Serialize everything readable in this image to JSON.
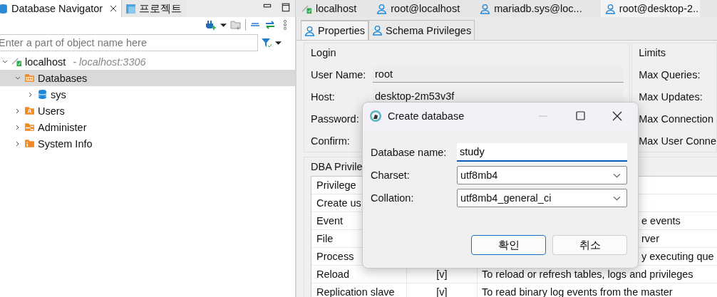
{
  "navigator": {
    "tabs": [
      {
        "label": "Database Navigator",
        "selected": true,
        "closable": true
      },
      {
        "label": "프로젝트",
        "selected": false,
        "closable": false
      }
    ],
    "search": {
      "placeholder": "Enter a part of object name here"
    },
    "tree": [
      {
        "label": "localhost",
        "detail": "- localhost:3306",
        "kind": "connection",
        "expanded": true,
        "selected": false,
        "children": [
          {
            "label": "Databases",
            "kind": "databases",
            "expanded": true,
            "selected": true,
            "children": [
              {
                "label": "sys",
                "kind": "schema",
                "expanded": false,
                "selected": false
              }
            ]
          },
          {
            "label": "Users",
            "kind": "users",
            "expanded": false,
            "selected": false
          },
          {
            "label": "Administer",
            "kind": "administer",
            "expanded": false,
            "selected": false
          },
          {
            "label": "System Info",
            "kind": "info",
            "expanded": false,
            "selected": false
          }
        ]
      }
    ]
  },
  "editor": {
    "tabs": [
      {
        "label": "localhost",
        "kind": "connection",
        "selected": false
      },
      {
        "label": "root@localhost",
        "kind": "user",
        "selected": false
      },
      {
        "label": "mariadb.sys@loc...",
        "kind": "user",
        "selected": false
      },
      {
        "label": "root@desktop-2..",
        "kind": "user",
        "selected": true
      }
    ],
    "subtabs": [
      {
        "label": "Properties",
        "selected": true
      },
      {
        "label": "Schema Privileges",
        "selected": false
      }
    ],
    "login": {
      "title": "Login",
      "fields": [
        {
          "label": "User Name:",
          "value": "root"
        },
        {
          "label": "Host:",
          "value": "desktop-2m53v3f"
        },
        {
          "label": "Password:"
        },
        {
          "label": "Confirm:"
        }
      ]
    },
    "limits": {
      "title": "Limits",
      "fields": [
        {
          "label": "Max Queries:"
        },
        {
          "label": "Max Updates:"
        },
        {
          "label": "Max Connection"
        },
        {
          "label": "Max User Conne"
        }
      ]
    },
    "privileges": {
      "title": "DBA Privile",
      "columns": [
        "Privilege"
      ],
      "rows": [
        {
          "name": "Create us"
        },
        {
          "name": "Event",
          "description": "e events"
        },
        {
          "name": "File",
          "description": "rver"
        },
        {
          "name": "Process",
          "description": "y executing que"
        },
        {
          "name": "Reload",
          "grant": "[v]",
          "description": "To reload or refresh tables, logs and privileges"
        },
        {
          "name": "Replication slave",
          "grant": "[v]",
          "description": "To read binary log events from the master"
        }
      ]
    }
  },
  "dialog": {
    "title": "Create database",
    "fields": [
      {
        "label": "Database name:",
        "value": "study",
        "kind": "text",
        "focused": true
      },
      {
        "label": "Charset:",
        "value": "utf8mb4",
        "kind": "select",
        "focused": false
      },
      {
        "label": "Collation:",
        "value": "utf8mb4_general_ci",
        "kind": "select",
        "focused": false
      }
    ],
    "buttons": [
      {
        "label": "확인",
        "default": true
      },
      {
        "label": "취소",
        "default": false
      }
    ]
  }
}
